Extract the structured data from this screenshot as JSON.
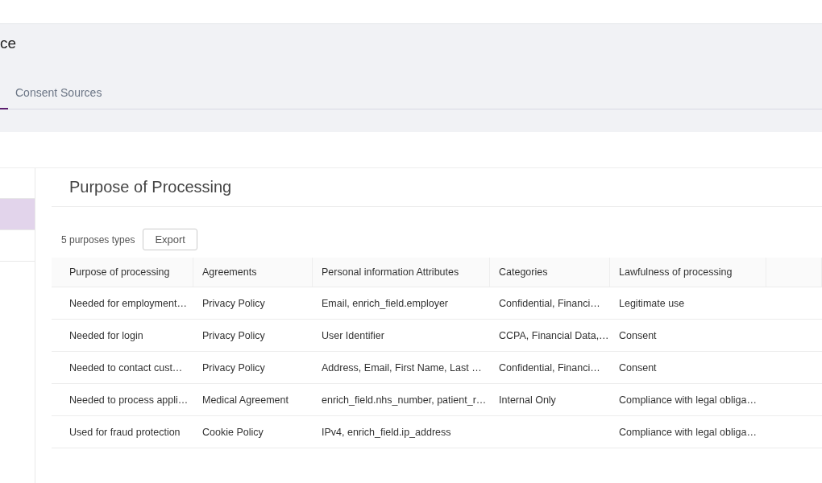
{
  "header": {
    "title": "ce",
    "tabs": [
      {
        "label": "Consent Sources",
        "selected": false
      }
    ]
  },
  "sidebar": {
    "items": [
      {
        "selected": false
      },
      {
        "selected": true
      },
      {
        "selected": false
      }
    ]
  },
  "panel": {
    "title": "Purpose of Processing",
    "count": "5 purposes types",
    "export_button": "Export"
  },
  "table": {
    "columns": [
      "Purpose of processing",
      "Agreements",
      "Personal information Attributes",
      "Categories",
      "Lawfulness of processing"
    ],
    "rows": [
      [
        "Needed for employment…",
        "Privacy Policy",
        "Email, enrich_field.employer",
        "Confidential, Financi…",
        "Legitimate use"
      ],
      [
        "Needed for login",
        "Privacy Policy",
        "User Identifier",
        "CCPA, Financial Data,…",
        "Consent"
      ],
      [
        "Needed to contact cust…",
        "Privacy Policy",
        "Address, Email, First Name, Last …",
        "Confidential, Financi…",
        "Consent"
      ],
      [
        "Needed to process appli…",
        "Medical Agreement",
        "enrich_field.nhs_number, patient_r…",
        "Internal Only",
        "Compliance with legal obliga…"
      ],
      [
        "Used for fraud protection",
        "Cookie Policy",
        "IPv4, enrich_field.ip_address",
        "",
        "Compliance with legal obliga…"
      ]
    ]
  }
}
